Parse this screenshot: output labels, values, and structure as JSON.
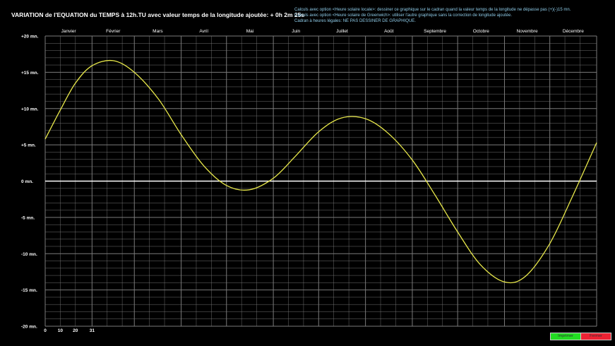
{
  "title": "VARIATION de l'EQUATION du TEMPS  à  12h.TU  avec valeur temps de la longitude ajoutée:  + 0h 2m 25s",
  "notes": [
    "Calculs avec option   <Heure solaire locale>:  dessiner ce graphique sur le cadran quand la valeur temps de la longitude ne dépasse pas (+)(-)15 mn.",
    "Calculs avec option   <Heure solaire de Greenwich>:  utiliser l'autre graphique sans la correction de longitude ajoutée.",
    "Cadran à heures légales:  NE PAS DESSINER DE GRAPHIQUE."
  ],
  "buttons": {
    "print": "Imprimer",
    "close": "Fermer"
  },
  "colors": {
    "background": "#000000",
    "grid": "#7a7a7a",
    "zero_line": "#ffffff",
    "curve": "#e8e84a",
    "notes_text": "#8ecbe8",
    "print_button": "#22dd22",
    "close_button": "#ee2233"
  },
  "chart_data": {
    "type": "line",
    "title": "VARIATION de l'EQUATION du TEMPS  à  12h.TU  avec valeur temps de la longitude ajoutée:  + 0h 2m 25s",
    "months": [
      "Janvier",
      "Février",
      "Mars",
      "Avril",
      "Mai",
      "Juin",
      "Juillet",
      "Août",
      "Septembre",
      "Octobre",
      "Novembre",
      "Décembre"
    ],
    "day_ticks": [
      "0",
      "10",
      "20",
      "31"
    ],
    "y_ticks": [
      "+20 mn.",
      "+15 mn.",
      "+10 mn.",
      "+5 mn.",
      "0 mn.",
      "-5 mn.",
      "-10 mn.",
      "-15 mn.",
      "-20 mn."
    ],
    "ylim": [
      -20,
      20
    ],
    "xlim": [
      0,
      365
    ],
    "grid": true,
    "series": [
      {
        "x": [
          0,
          10,
          20,
          31,
          45,
          59,
          75,
          90,
          105,
          120,
          135,
          151,
          165,
          181,
          196,
          212,
          227,
          243,
          258,
          273,
          288,
          304,
          318,
          334,
          349,
          365
        ],
        "values": [
          5.8,
          9.8,
          13.5,
          15.9,
          16.6,
          15.0,
          11.3,
          6.4,
          2.1,
          -0.6,
          -1.2,
          0.4,
          3.3,
          6.8,
          8.7,
          8.6,
          6.6,
          2.9,
          -1.9,
          -7.0,
          -11.5,
          -13.9,
          -13.1,
          -8.6,
          -2.1,
          5.3
        ]
      }
    ]
  }
}
